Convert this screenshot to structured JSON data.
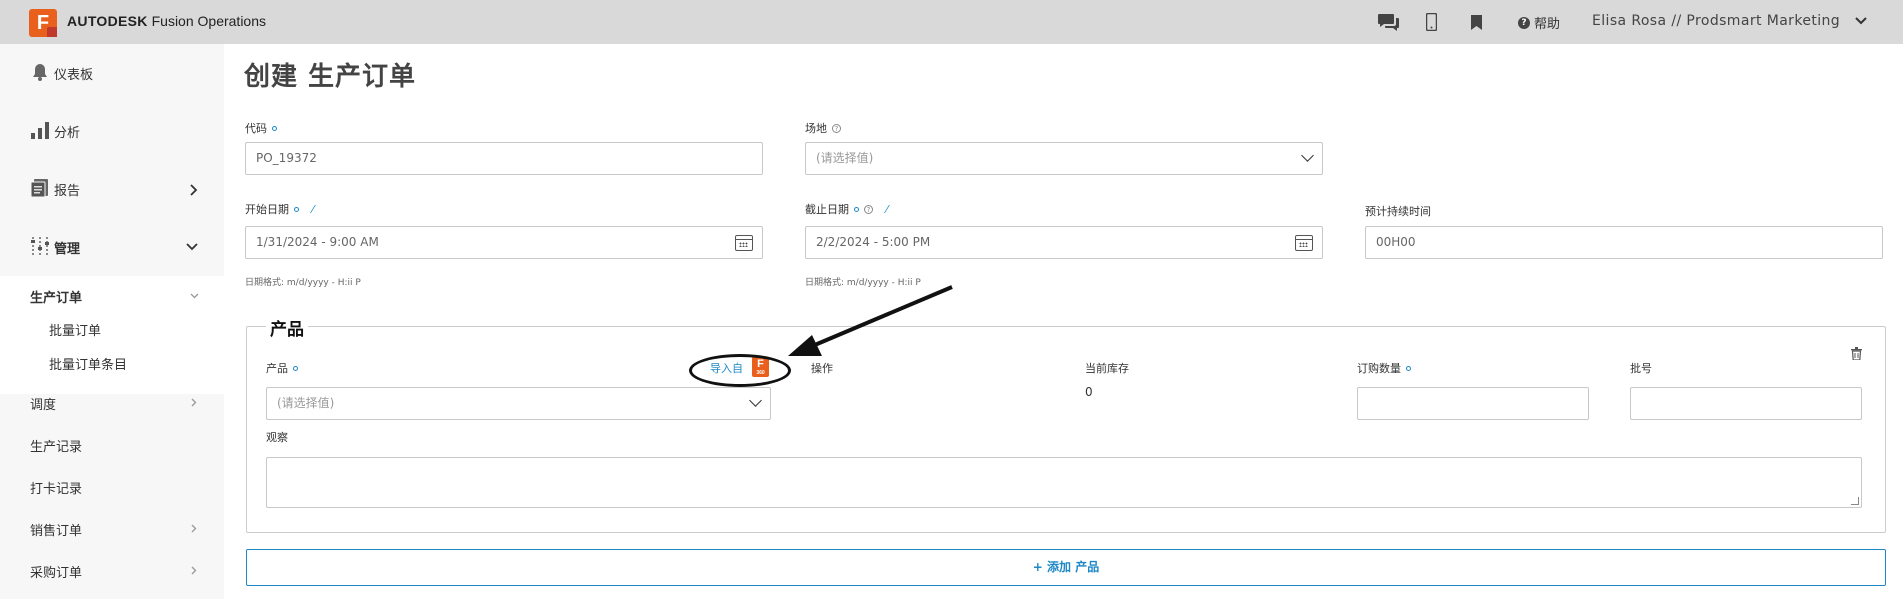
{
  "header": {
    "logo_letter": "F",
    "brand_bold": "AUTODESK",
    "brand_rest": "Fusion Operations",
    "icons": [
      "chat-icon",
      "mobile-icon",
      "bookmark-icon"
    ],
    "help_label": "帮助",
    "user": "Elisa Rosa // Prodsmart Marketing"
  },
  "sidebar": {
    "items": [
      {
        "label": "仪表板",
        "icon": "bell-icon"
      },
      {
        "label": "分析",
        "icon": "bar-chart-icon"
      },
      {
        "label": "报告",
        "icon": "report-icon"
      },
      {
        "label": "管理",
        "icon": "sliders-icon"
      }
    ],
    "section": "生产订单",
    "subitems": [
      "批量订单",
      "批量订单条目"
    ],
    "links": [
      "调度",
      "生产记录",
      "打卡记录",
      "销售订单",
      "采购订单"
    ]
  },
  "page": {
    "title": "创建 生产订单"
  },
  "form": {
    "code_label": "代码",
    "code_value": "PO_19372",
    "site_label": "场地",
    "site_placeholder": "(请选择值)",
    "start_label": "开始日期",
    "start_value": "1/31/2024 - 9:00 AM",
    "end_label": "截止日期",
    "end_value": "2/2/2024 - 5:00 PM",
    "duration_label": "预计持续时间",
    "duration_value": "00H00",
    "date_hint": "日期格式: m/d/yyyy - H:ii P"
  },
  "products": {
    "legend": "产品",
    "product_label": "产品",
    "import_label": "导入自",
    "badge_letter": "F",
    "badge_sub": "360",
    "operation_label": "操作",
    "stock_label": "当前库存",
    "stock_value": "0",
    "order_qty_label": "订购数量",
    "batch_label": "批号",
    "product_placeholder": "(请选择值)",
    "notes_label": "观察",
    "add_button": "添加 产品"
  }
}
